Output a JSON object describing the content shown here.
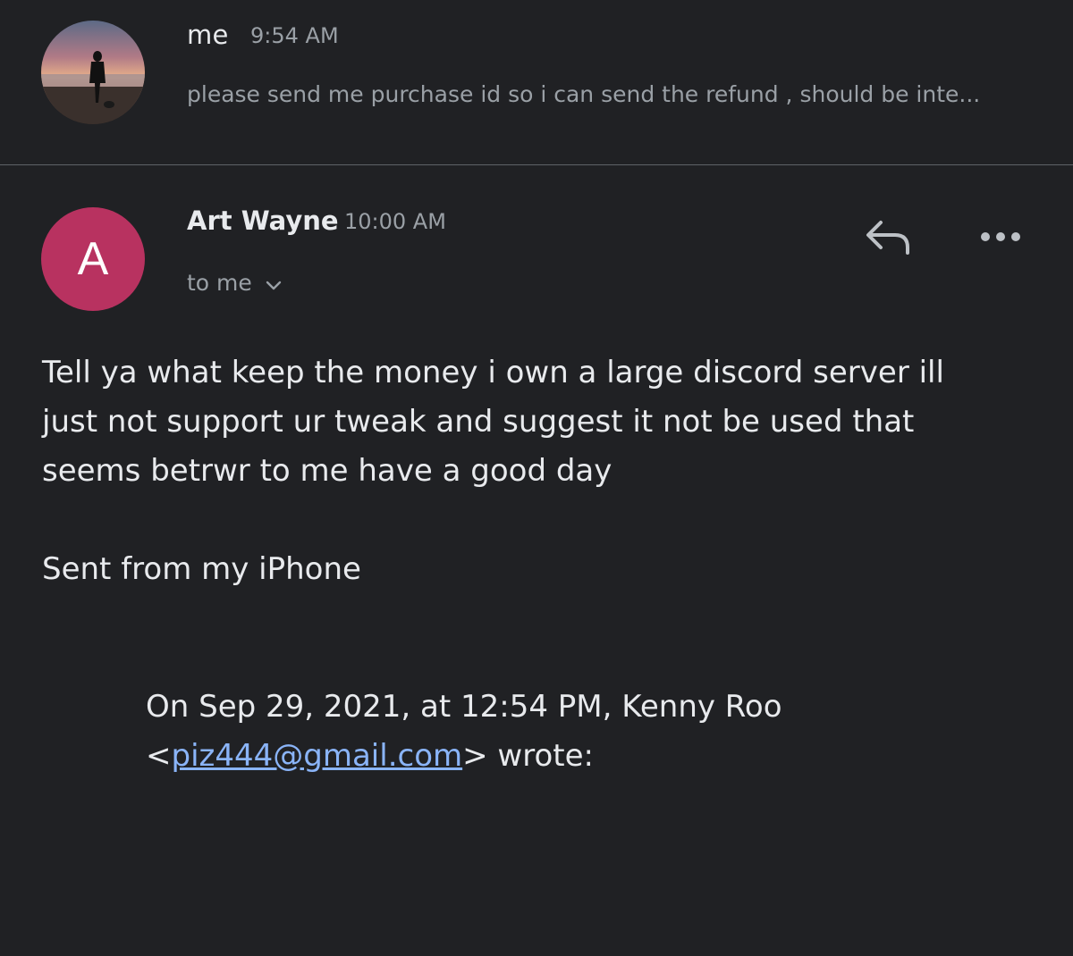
{
  "collapsed_message": {
    "sender": "me",
    "time": "9:54 AM",
    "snippet": "please send me purchase id so i can send the refund , should be inte..."
  },
  "expanded_message": {
    "avatar_letter": "A",
    "avatar_color": "#b83260",
    "sender": "Art Wayne",
    "time": "10:00 AM",
    "recipients": "to me",
    "body_lines": [
      "Tell ya what keep the money i own a large discord server ill",
      "just not support ur tweak and suggest it not be used that",
      "seems betrwr to me have a good day"
    ],
    "signature": "Sent from my iPhone",
    "quote": {
      "line1": "On Sep 29, 2021, at 12:54 PM, Kenny Roo",
      "open_bracket": "<",
      "email": "piz444@gmail.com",
      "close": "> wrote:"
    }
  },
  "icons": {
    "reply": "reply-icon",
    "more": "more-horizontal-icon",
    "expand": "chevron-down-icon"
  },
  "colors": {
    "background": "#202124",
    "text_primary": "#e8eaed",
    "text_secondary": "#9aa0a6",
    "link": "#8ab4f8"
  }
}
